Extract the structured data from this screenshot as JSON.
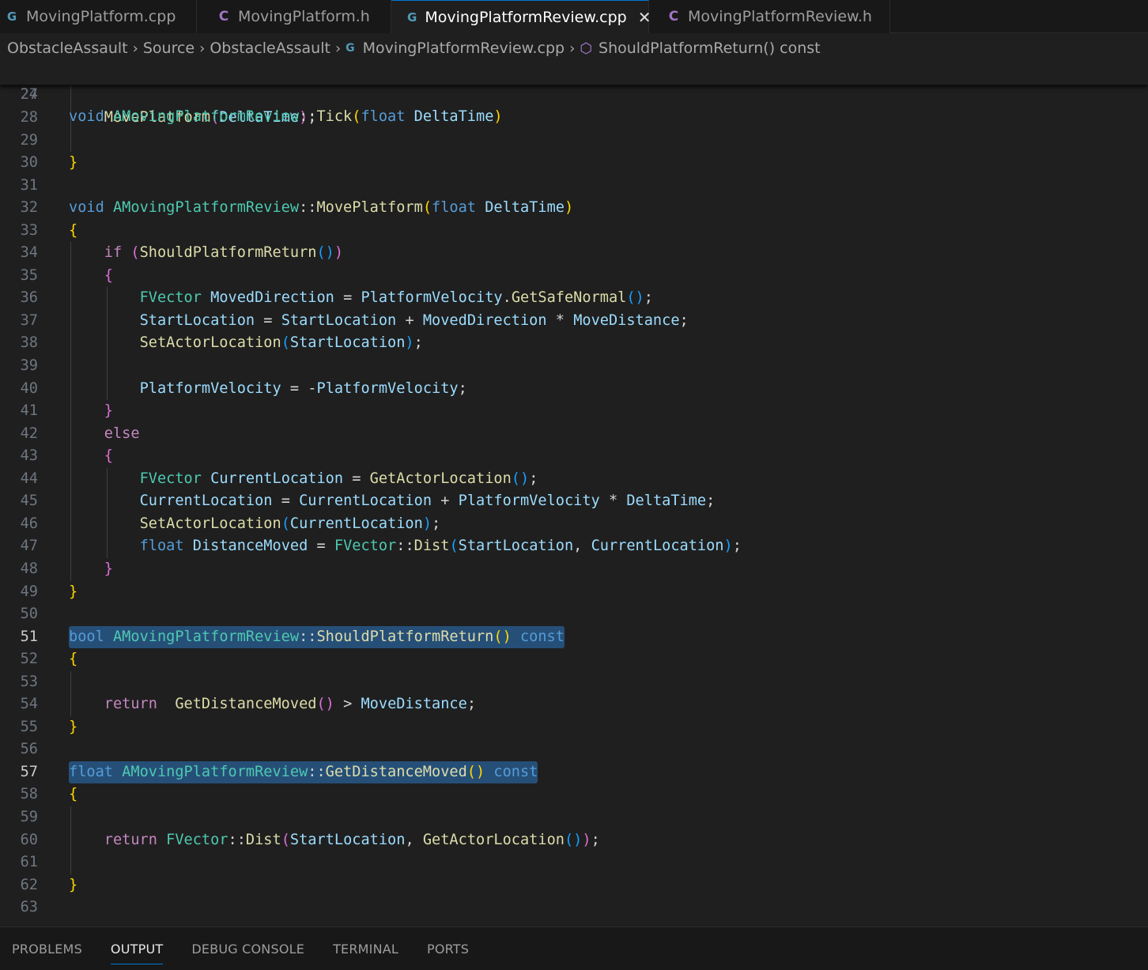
{
  "tabs": [
    {
      "label": "MovingPlatform.cpp",
      "icon": "cpp-file-icon",
      "active": false
    },
    {
      "label": "MovingPlatform.h",
      "icon": "c-header-file-icon",
      "active": false
    },
    {
      "label": "MovingPlatformReview.cpp",
      "icon": "cpp-file-icon",
      "active": true
    },
    {
      "label": "MovingPlatformReview.h",
      "icon": "c-header-file-icon",
      "active": false
    }
  ],
  "breadcrumb": {
    "items": [
      "ObstacleAssault",
      "Source",
      "ObstacleAssault",
      "MovingPlatformReview.cpp",
      "ShouldPlatformReturn() const"
    ]
  },
  "editor": {
    "sticky_line": {
      "number": "24",
      "code": "void AMovingPlatformReview::Tick(float DeltaTime)"
    },
    "lines": [
      {
        "number": "27",
        "code": ""
      },
      {
        "number": "28",
        "code": "    MovePlatform(DeltaTime);"
      },
      {
        "number": "29",
        "code": ""
      },
      {
        "number": "30",
        "code": "}"
      },
      {
        "number": "31",
        "code": ""
      },
      {
        "number": "32",
        "code": "void AMovingPlatformReview::MovePlatform(float DeltaTime)"
      },
      {
        "number": "33",
        "code": "{"
      },
      {
        "number": "34",
        "code": "    if (ShouldPlatformReturn())"
      },
      {
        "number": "35",
        "code": "    {"
      },
      {
        "number": "36",
        "code": "        FVector MovedDirection = PlatformVelocity.GetSafeNormal();"
      },
      {
        "number": "37",
        "code": "        StartLocation = StartLocation + MovedDirection * MoveDistance;"
      },
      {
        "number": "38",
        "code": "        SetActorLocation(StartLocation);"
      },
      {
        "number": "39",
        "code": ""
      },
      {
        "number": "40",
        "code": "        PlatformVelocity = -PlatformVelocity;"
      },
      {
        "number": "41",
        "code": "    }"
      },
      {
        "number": "42",
        "code": "    else"
      },
      {
        "number": "43",
        "code": "    {"
      },
      {
        "number": "44",
        "code": "        FVector CurrentLocation = GetActorLocation();"
      },
      {
        "number": "45",
        "code": "        CurrentLocation = CurrentLocation + PlatformVelocity * DeltaTime;"
      },
      {
        "number": "46",
        "code": "        SetActorLocation(CurrentLocation);"
      },
      {
        "number": "47",
        "code": "        float DistanceMoved = FVector::Dist(StartLocation, CurrentLocation);"
      },
      {
        "number": "48",
        "code": "    }"
      },
      {
        "number": "49",
        "code": "}"
      },
      {
        "number": "50",
        "code": ""
      },
      {
        "number": "51",
        "code": "bool AMovingPlatformReview::ShouldPlatformReturn() const"
      },
      {
        "number": "52",
        "code": "{"
      },
      {
        "number": "53",
        "code": ""
      },
      {
        "number": "54",
        "code": "    return  GetDistanceMoved() > MoveDistance;"
      },
      {
        "number": "55",
        "code": "}"
      },
      {
        "number": "56",
        "code": ""
      },
      {
        "number": "57",
        "code": "float AMovingPlatformReview::GetDistanceMoved() const"
      },
      {
        "number": "58",
        "code": "{"
      },
      {
        "number": "59",
        "code": ""
      },
      {
        "number": "60",
        "code": "    return FVector::Dist(StartLocation, GetActorLocation());"
      },
      {
        "number": "61",
        "code": ""
      },
      {
        "number": "62",
        "code": "}"
      },
      {
        "number": "63",
        "code": ""
      }
    ]
  },
  "panel": {
    "tabs": [
      "PROBLEMS",
      "OUTPUT",
      "DEBUG CONSOLE",
      "TERMINAL",
      "PORTS"
    ],
    "active": "OUTPUT"
  },
  "colors": {
    "background": "#1f1f1f",
    "tabbar": "#181818",
    "selection": "#264f78",
    "keyword": "#569cd6",
    "control": "#c586c0",
    "type": "#4ec9b0",
    "function": "#dcdcaa",
    "variable": "#9cdcfe",
    "accent": "#0078d4"
  }
}
